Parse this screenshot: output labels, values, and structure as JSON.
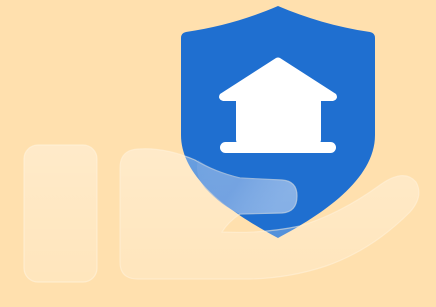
{
  "illustration": {
    "subject": "home-insurance-icon",
    "icons": [
      "shield-icon",
      "house-icon",
      "hand-icon"
    ]
  },
  "colors": {
    "background": "#ffe0ae",
    "shield": "#1f6fd0",
    "house": "#ffffff",
    "hand_glass": "#ffffff",
    "hand_edge": "#fff3dd"
  }
}
